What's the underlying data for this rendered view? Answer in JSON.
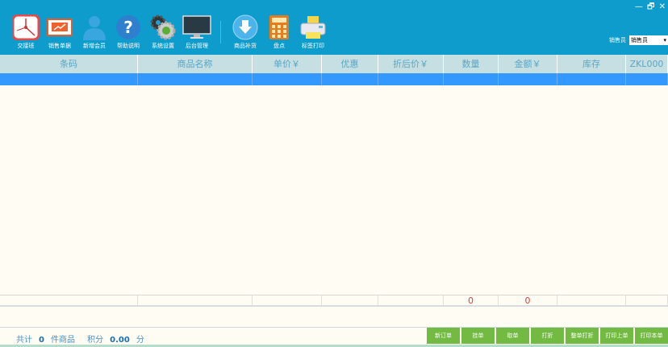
{
  "window_controls": {
    "minimize": "—",
    "restore": "🗗",
    "close": "✕"
  },
  "toolbar": [
    {
      "label": "交接班",
      "icon": "clock-icon"
    },
    {
      "label": "销售单据",
      "icon": "sales-chart-icon"
    },
    {
      "label": "新增会员",
      "icon": "user-icon"
    },
    {
      "label": "帮助说明",
      "icon": "help-icon"
    },
    {
      "label": "系统设置",
      "icon": "gear-icon"
    },
    {
      "label": "后台管理",
      "icon": "monitor-icon"
    },
    {
      "label": "商品补货",
      "icon": "download-icon"
    },
    {
      "label": "盘点",
      "icon": "calculator-icon"
    },
    {
      "label": "标签打印",
      "icon": "printer-icon"
    }
  ],
  "seller": {
    "label": "销售员",
    "value": "销售员"
  },
  "columns": [
    "条码",
    "商品名称",
    "单价￥",
    "优惠",
    "折后价￥",
    "数量",
    "金额￥",
    "库存",
    "ZKL000"
  ],
  "totals": [
    "",
    "",
    "",
    "",
    "",
    "0",
    "0",
    "",
    ""
  ],
  "summary": {
    "total_label": "共计",
    "count": "0",
    "items_label": "件商品",
    "points_label": "积分",
    "points": "0.00",
    "points_unit": "分"
  },
  "buttons": [
    "新订单",
    "挂单",
    "取单",
    "打折",
    "整单打折",
    "打印上单",
    "打印本单"
  ]
}
